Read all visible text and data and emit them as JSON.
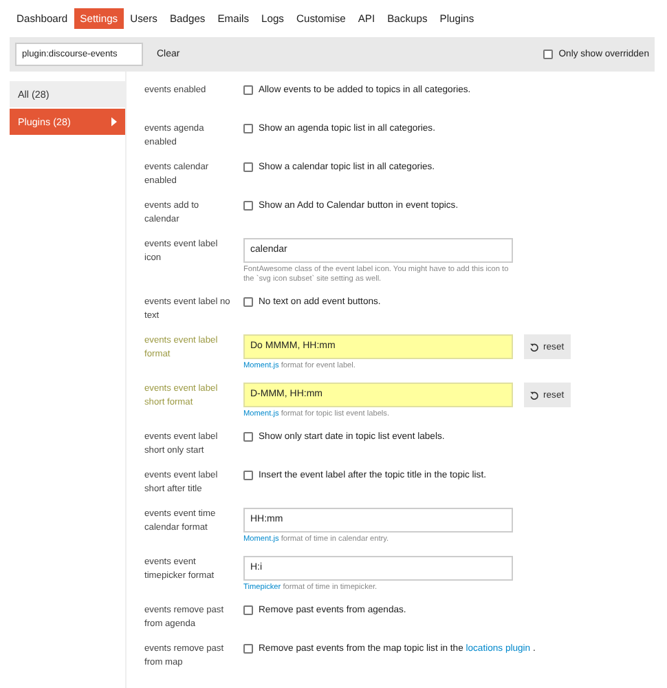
{
  "nav": [
    {
      "label": "Dashboard",
      "selected": false
    },
    {
      "label": "Settings",
      "selected": true
    },
    {
      "label": "Users",
      "selected": false
    },
    {
      "label": "Badges",
      "selected": false
    },
    {
      "label": "Emails",
      "selected": false
    },
    {
      "label": "Logs",
      "selected": false
    },
    {
      "label": "Customise",
      "selected": false
    },
    {
      "label": "API",
      "selected": false
    },
    {
      "label": "Backups",
      "selected": false
    },
    {
      "label": "Plugins",
      "selected": false
    }
  ],
  "filter": {
    "value": "plugin:discourse-events",
    "clear": "Clear",
    "only_overridden": {
      "label": "Only show overridden",
      "checked": false
    }
  },
  "sidebar": [
    {
      "label": "All (28)",
      "selected": false
    },
    {
      "label": "Plugins (28)",
      "selected": true
    }
  ],
  "settings": [
    {
      "kind": "checkbox",
      "name": "events enabled",
      "overridden": false,
      "checked": false,
      "parts": [
        {
          "kind": "text",
          "text": "Allow events to be added to topics in all categories."
        }
      ]
    },
    {
      "kind": "checkbox",
      "name": "events agenda enabled",
      "overridden": false,
      "checked": false,
      "parts": [
        {
          "kind": "text",
          "text": "Show an agenda topic list in all categories."
        }
      ]
    },
    {
      "kind": "checkbox",
      "name": "events calendar enabled",
      "overridden": false,
      "checked": false,
      "parts": [
        {
          "kind": "text",
          "text": "Show a calendar topic list in all categories."
        }
      ]
    },
    {
      "kind": "checkbox",
      "name": "events add to calendar",
      "overridden": false,
      "checked": false,
      "parts": [
        {
          "kind": "text",
          "text": "Show an Add to Calendar button in event topics."
        }
      ]
    },
    {
      "kind": "text",
      "name": "events event label icon",
      "overridden": false,
      "value": "calendar",
      "parts": [
        {
          "kind": "text",
          "text": "FontAwesome class of the event label icon. You might have to add this icon to the `svg icon subset` site setting as well."
        }
      ]
    },
    {
      "kind": "checkbox",
      "name": "events event label no text",
      "overridden": false,
      "checked": false,
      "parts": [
        {
          "kind": "text",
          "text": "No text on add event buttons."
        }
      ]
    },
    {
      "kind": "text",
      "name": "events event label format",
      "overridden": true,
      "reset": "reset",
      "value": "Do MMMM, HH:mm",
      "parts": [
        {
          "kind": "link",
          "text": "Moment.js"
        },
        {
          "kind": "text",
          "text": " format for event label."
        }
      ]
    },
    {
      "kind": "text",
      "name": "events event label short format",
      "overridden": true,
      "reset": "reset",
      "value": "D-MMM, HH:mm",
      "parts": [
        {
          "kind": "link",
          "text": "Moment.js"
        },
        {
          "kind": "text",
          "text": " format for topic list event labels."
        }
      ]
    },
    {
      "kind": "checkbox",
      "name": "events event label short only start",
      "overridden": false,
      "checked": false,
      "parts": [
        {
          "kind": "text",
          "text": "Show only start date in topic list event labels."
        }
      ]
    },
    {
      "kind": "checkbox",
      "name": "events event label short after title",
      "overridden": false,
      "checked": false,
      "parts": [
        {
          "kind": "text",
          "text": "Insert the event label after the topic title in the topic list."
        }
      ]
    },
    {
      "kind": "text",
      "name": "events event time calendar format",
      "overridden": false,
      "value": "HH:mm",
      "parts": [
        {
          "kind": "link",
          "text": "Moment.js"
        },
        {
          "kind": "text",
          "text": " format of time in calendar entry."
        }
      ]
    },
    {
      "kind": "text",
      "name": "events event timepicker format",
      "overridden": false,
      "value": "H:i",
      "parts": [
        {
          "kind": "link",
          "text": "Timepicker"
        },
        {
          "kind": "text",
          "text": " format of time in timepicker."
        }
      ]
    },
    {
      "kind": "checkbox",
      "name": "events remove past from agenda",
      "overridden": false,
      "checked": false,
      "parts": [
        {
          "kind": "text",
          "text": "Remove past events from agendas."
        }
      ]
    },
    {
      "kind": "checkbox",
      "name": "events remove past from map",
      "overridden": false,
      "checked": false,
      "parts": [
        {
          "kind": "text",
          "text": "Remove past events from the map topic list in the "
        },
        {
          "kind": "link",
          "text": "locations plugin"
        },
        {
          "kind": "text",
          "text": " ."
        }
      ]
    }
  ]
}
